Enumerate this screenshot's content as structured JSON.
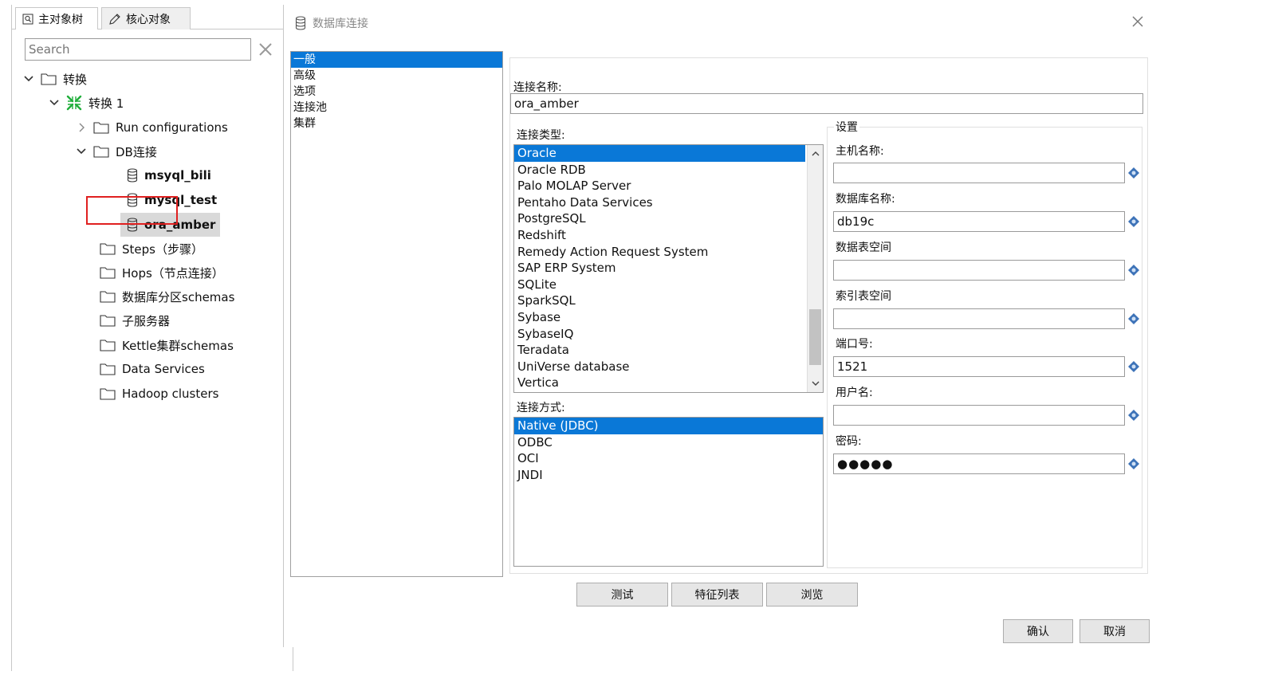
{
  "left_panel": {
    "tabs": [
      {
        "label": "主对象树",
        "icon": "search-icon"
      },
      {
        "label": "核心对象",
        "icon": "pencil-icon"
      }
    ],
    "search": {
      "placeholder": "Search",
      "clear_icon": "close-icon"
    },
    "tree": [
      {
        "label": "转换",
        "icon": "folder-icon",
        "expanded": true
      },
      {
        "label": "转换 1",
        "icon": "transformation-icon",
        "expanded": true
      },
      {
        "label": "Run configurations",
        "icon": "folder-icon",
        "expanded": false
      },
      {
        "label": "DB连接",
        "icon": "folder-icon",
        "expanded": true
      },
      {
        "label": "msyql_bili",
        "icon": "database-icon"
      },
      {
        "label": "mysql_test",
        "icon": "database-icon"
      },
      {
        "label": "ora_amber",
        "icon": "database-icon",
        "selected": true
      },
      {
        "label": "Steps（步骤）",
        "icon": "folder-icon"
      },
      {
        "label": "Hops（节点连接）",
        "icon": "folder-icon"
      },
      {
        "label": "数据库分区schemas",
        "icon": "folder-icon"
      },
      {
        "label": "子服务器",
        "icon": "folder-icon"
      },
      {
        "label": "Kettle集群schemas",
        "icon": "folder-icon"
      },
      {
        "label": "Data Services",
        "icon": "folder-icon"
      },
      {
        "label": "Hadoop clusters",
        "icon": "folder-icon"
      }
    ],
    "highlight_color": "#e02020"
  },
  "dialog": {
    "title": "数据库连接",
    "nav": [
      "一般",
      "高级",
      "选项",
      "连接池",
      "集群"
    ],
    "nav_active": 0,
    "conn_name_label": "连接名称:",
    "conn_name_value": "ora_amber",
    "conn_type_label": "连接类型:",
    "conn_types": [
      "Oracle",
      "Oracle RDB",
      "Palo MOLAP Server",
      "Pentaho Data Services",
      "PostgreSQL",
      "Redshift",
      "Remedy Action Request System",
      "SAP ERP System",
      "SQLite",
      "SparkSQL",
      "Sybase",
      "SybaseIQ",
      "Teradata",
      "UniVerse database",
      "Vertica"
    ],
    "conn_type_selected": 0,
    "access_label": "连接方式:",
    "access_methods": [
      "Native (JDBC)",
      "ODBC",
      "OCI",
      "JNDI"
    ],
    "access_selected": 0,
    "settings": {
      "title": "设置",
      "host_label": "主机名称:",
      "host_value": "",
      "dbname_label": "数据库名称:",
      "dbname_value": "db19c",
      "tablespace_label": "数据表空间",
      "tablespace_value": "",
      "index_tablespace_label": "索引表空间",
      "index_tablespace_value": "",
      "port_label": "端口号:",
      "port_value": "1521",
      "user_label": "用户名:",
      "user_value": "",
      "password_label": "密码:",
      "password_value": "●●●●●"
    },
    "buttons": {
      "test": "测试",
      "features": "特征列表",
      "explore": "浏览",
      "ok": "确认",
      "cancel": "取消"
    },
    "accent_color": "#0a78d7"
  }
}
